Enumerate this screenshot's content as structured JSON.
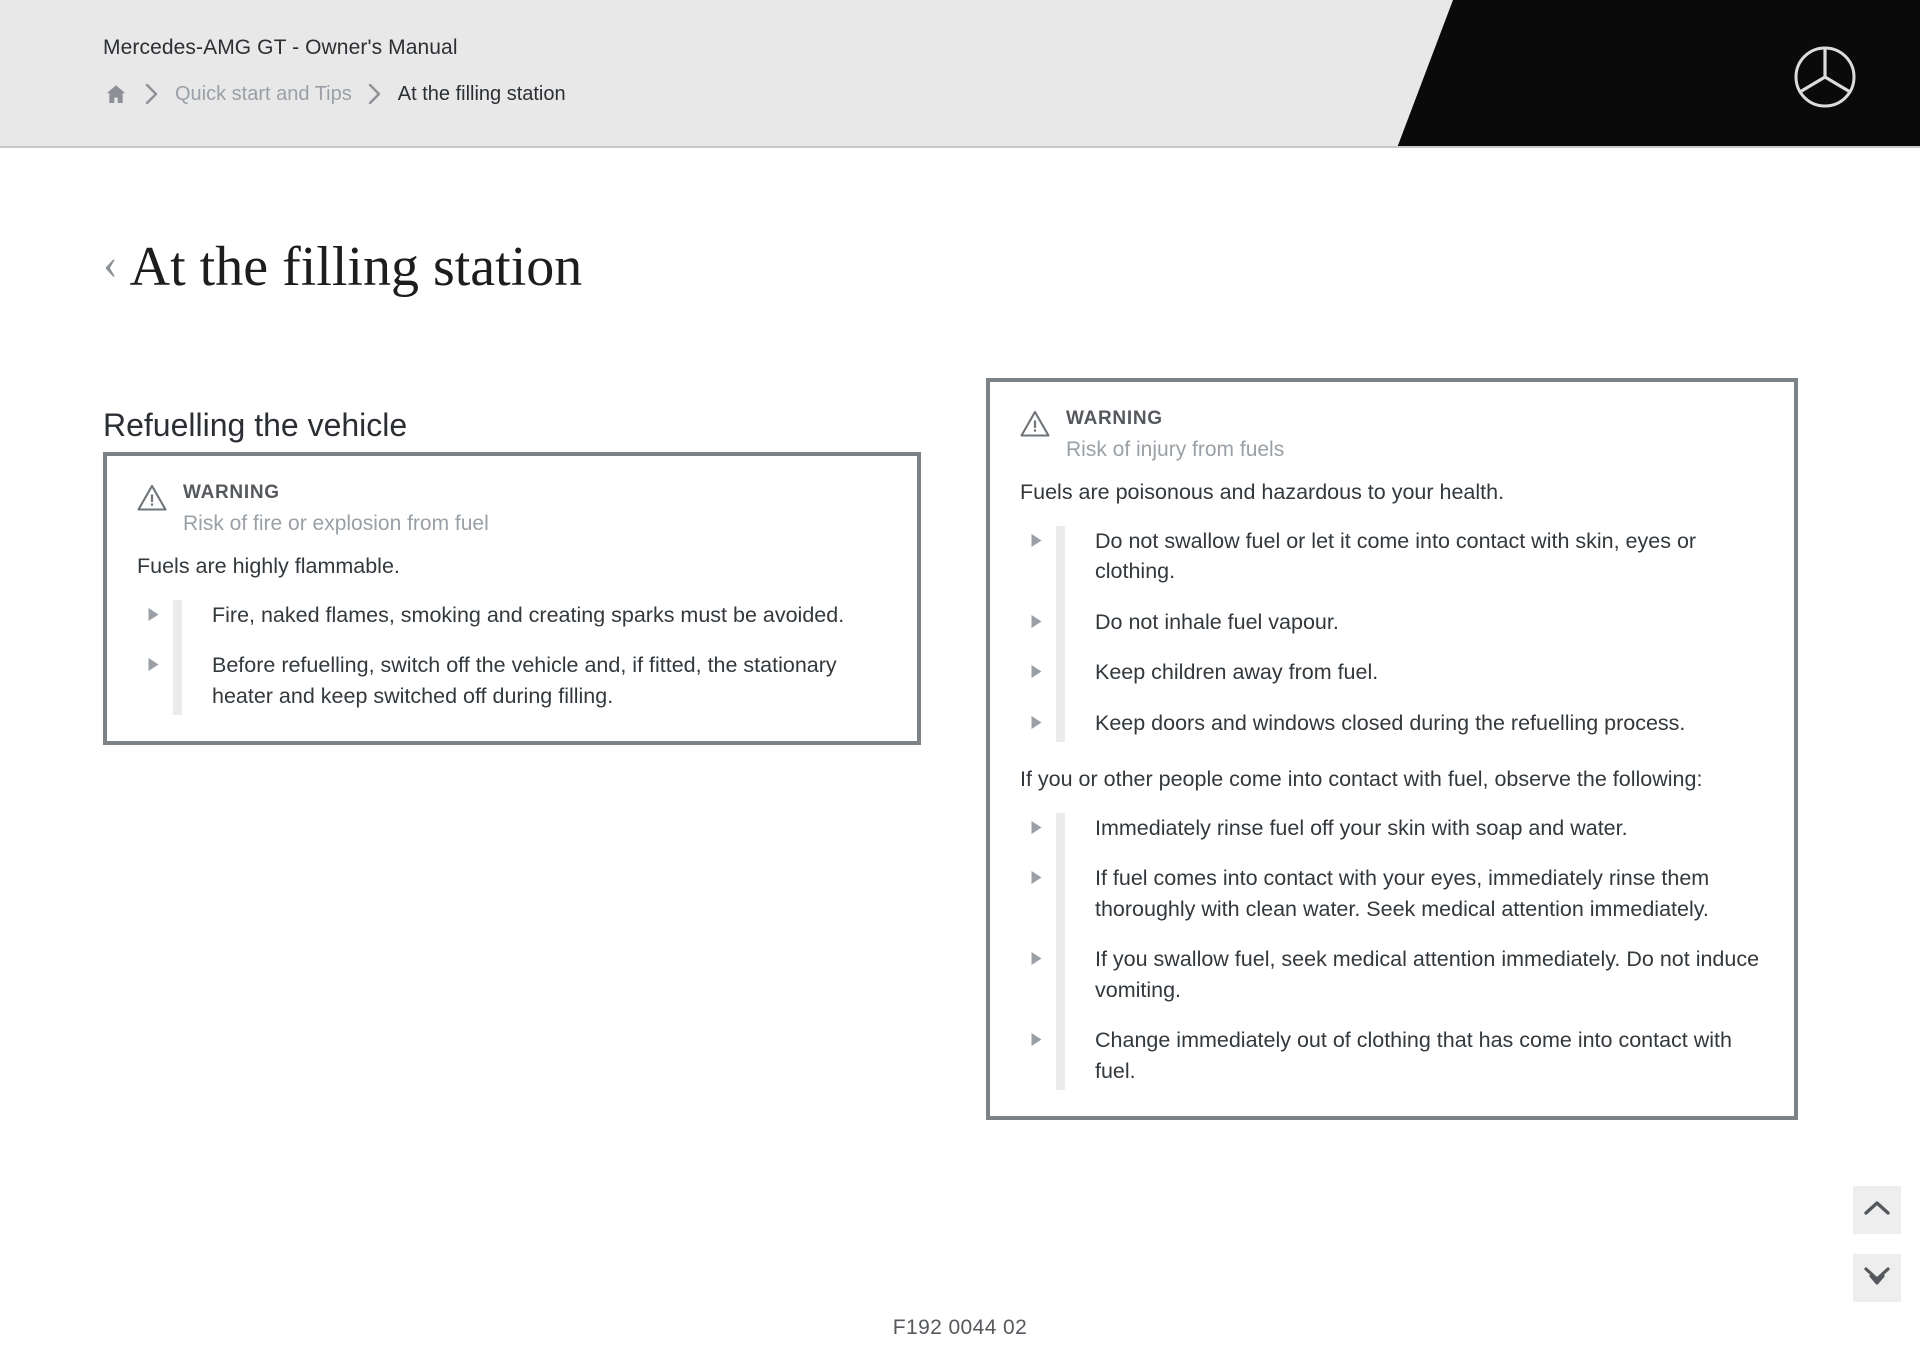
{
  "header": {
    "manual_title": "Mercedes-AMG GT - Owner's Manual",
    "breadcrumb": {
      "home_icon": "home-icon",
      "separator_icon": "chevron-right-icon",
      "parent": "Quick start and Tips",
      "current": "At the filling station"
    },
    "brand_logo": "mercedes-benz-star-icon",
    "background_color": "#e8e8e8",
    "accent_block_color": "#0a0a0a"
  },
  "page": {
    "back_icon": "chevron-left-icon",
    "title": "At the filling station",
    "section_heading": "Refuelling the vehicle"
  },
  "warning_left": {
    "icon": "warning-triangle-icon",
    "label": "WARNING",
    "subtitle": "Risk of fire or explosion from fuel",
    "paragraph": "Fuels are highly flammable.",
    "bullet_icon": "triangle-right-bullet-icon",
    "items": [
      "Fire, naked flames, smoking and creating sparks must be avoi­ded.",
      "Before refuelling, switch off the vehicle and, if fitted, the sta­tionary heater and keep switched off during filling."
    ]
  },
  "warning_right": {
    "icon": "warning-triangle-icon",
    "label": "WARNING",
    "subtitle": "Risk of injury from fuels",
    "paragraph": "Fuels are poisonous and hazardous to your health.",
    "bullet_icon": "triangle-right-bullet-icon",
    "items_top": [
      "Do not swallow fuel or let it come into contact with skin, eyes or clothing.",
      "Do not inhale fuel vapour.",
      "Keep children away from fuel.",
      "Keep doors and windows closed during the refuelling process."
    ],
    "paragraph_2": "If you or other people come into contact with fuel, observe the follow­ing:",
    "items_bottom": [
      "Immediately rinse fuel off your skin with soap and water.",
      "If fuel comes into contact with your eyes, immediately rinse them thoroughly with clean water. Seek medical attention immediately.",
      "If you swallow fuel, seek medical attention immediately. Do not induce vomiting.",
      "Change immediately out of clothing that has come into contact with fuel."
    ]
  },
  "side_buttons": [
    {
      "name": "scroll-to-top-button",
      "icon": "chevron-up-icon"
    },
    {
      "name": "scroll-to-bottom-button",
      "icon": "double-chevron-down-icon"
    }
  ],
  "footer": {
    "document_code": "F192 0044 02"
  },
  "colors": {
    "warning_border": "#7d8287",
    "text": "#33383c",
    "muted_text": "#9aa0a6",
    "rail": "#ebebeb"
  }
}
